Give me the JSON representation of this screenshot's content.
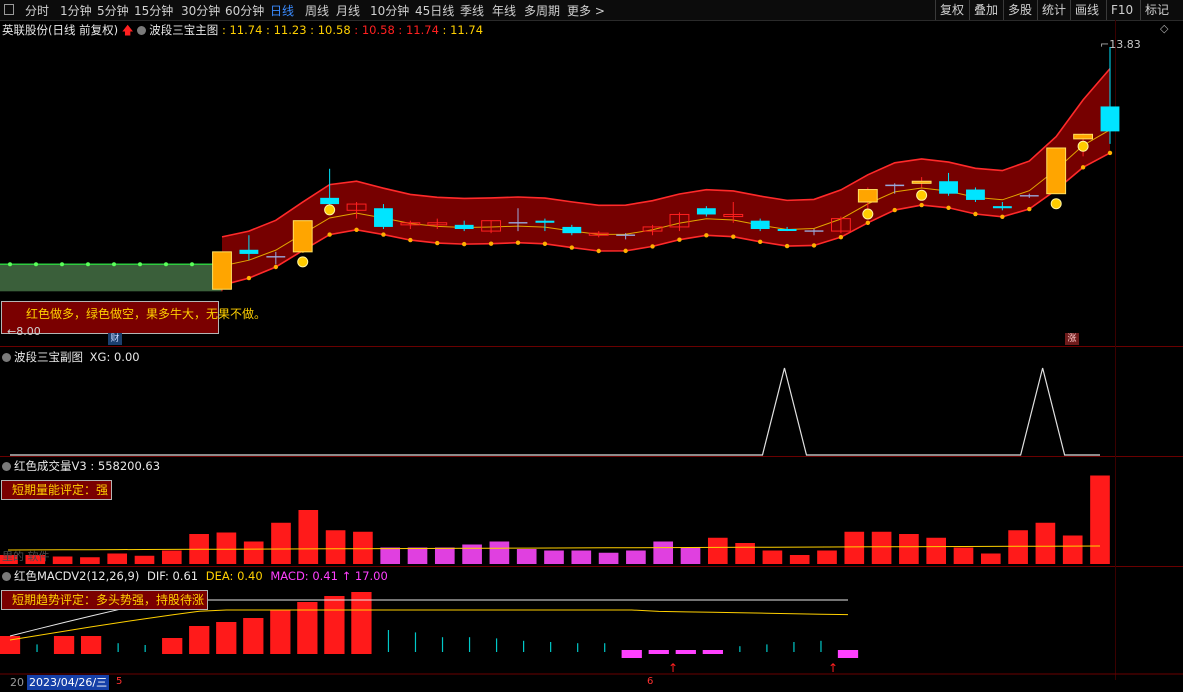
{
  "toolbar": {
    "menu_icon": "menu-icon",
    "tabs": [
      "分时",
      "1分钟",
      "5分钟",
      "15分钟",
      "30分钟",
      "60分钟",
      "日线",
      "周线",
      "月线",
      "10分钟",
      "45日线",
      "季线",
      "年线",
      "多周期",
      "更多 >"
    ],
    "active_tab": "日线",
    "right_buttons": [
      "复权",
      "叠加",
      "多股",
      "统计",
      "画线",
      "F10",
      "标记"
    ]
  },
  "main_panel": {
    "stock_title": "英联股份(日线 前复权)",
    "indicator_name": "波段三宝主图",
    "values": [
      {
        "text": "11.74",
        "color": "#ffd000"
      },
      {
        "text": "11.23",
        "color": "#ffd000"
      },
      {
        "text": "10.58",
        "color": "#ffd000"
      },
      {
        "text": "10.58",
        "color": "#ff2020"
      },
      {
        "text": "11.74",
        "color": "#ff2020"
      },
      {
        "text": "11.74",
        "color": "#ffd000"
      }
    ],
    "high_label": "13.83",
    "low_label": "←8.00",
    "callout": "红色做多，绿色做空，果多牛大，无果不做。",
    "marker_cai": "财",
    "marker_zhang": "涨"
  },
  "panel2": {
    "name": "波段三宝副图",
    "values": "XG: 0.00"
  },
  "panel3": {
    "name": "红色成交量V3",
    "values": ": 558200.63",
    "callout": "短期量能评定：强",
    "overlay_text": "里的 软件"
  },
  "panel4": {
    "name": "红色MACDV2(12,26,9)",
    "dif": "DIF: 0.61",
    "dea": "DEA: 0.40",
    "macd": "MACD: 0.41 ↑ 17.00",
    "callout": "短期趋势评定：多头势强，持股待涨",
    "date_prefix": "20",
    "date": "2023/04/26/三",
    "axis_marks": [
      "5",
      "6"
    ]
  },
  "colors": {
    "up": "#ff2020",
    "down": "#00e5ff",
    "channel": "#8b0000",
    "green_band": "#3a5f3a",
    "ma": "#ffd000",
    "accent": "#3a8bff"
  },
  "chart_data": {
    "type": "candlestick",
    "y_axis_price_range": [
      7.5,
      14.0
    ],
    "candles": [
      {
        "o": 8.0,
        "h": 8.9,
        "l": 7.95,
        "c": 8.9,
        "dir": "up",
        "gold": true
      },
      {
        "o": 8.95,
        "h": 9.3,
        "l": 8.7,
        "c": 8.85,
        "dir": "down"
      },
      {
        "o": 8.75,
        "h": 8.9,
        "l": 8.6,
        "c": 8.78,
        "dir": "cross"
      },
      {
        "o": 8.9,
        "h": 9.65,
        "l": 8.9,
        "c": 9.65,
        "dir": "up",
        "gold": true
      },
      {
        "o": 10.2,
        "h": 10.9,
        "l": 9.8,
        "c": 10.05,
        "dir": "down"
      },
      {
        "o": 9.9,
        "h": 10.1,
        "l": 9.7,
        "c": 10.05,
        "dir": "up"
      },
      {
        "o": 9.95,
        "h": 10.05,
        "l": 9.45,
        "c": 9.5,
        "dir": "down"
      },
      {
        "o": 9.55,
        "h": 9.65,
        "l": 9.45,
        "c": 9.6,
        "dir": "up"
      },
      {
        "o": 9.55,
        "h": 9.7,
        "l": 9.45,
        "c": 9.6,
        "dir": "up"
      },
      {
        "o": 9.55,
        "h": 9.65,
        "l": 9.4,
        "c": 9.45,
        "dir": "down"
      },
      {
        "o": 9.4,
        "h": 9.65,
        "l": 9.35,
        "c": 9.65,
        "dir": "up"
      },
      {
        "o": 9.6,
        "h": 9.95,
        "l": 9.4,
        "c": 9.6,
        "dir": "cross"
      },
      {
        "o": 9.65,
        "h": 9.7,
        "l": 9.4,
        "c": 9.6,
        "dir": "down"
      },
      {
        "o": 9.5,
        "h": 9.55,
        "l": 9.3,
        "c": 9.35,
        "dir": "down"
      },
      {
        "o": 9.3,
        "h": 9.4,
        "l": 9.25,
        "c": 9.35,
        "dir": "up"
      },
      {
        "o": 9.3,
        "h": 9.35,
        "l": 9.2,
        "c": 9.3,
        "dir": "cross"
      },
      {
        "o": 9.4,
        "h": 9.55,
        "l": 9.3,
        "c": 9.5,
        "dir": "up"
      },
      {
        "o": 9.5,
        "h": 9.85,
        "l": 9.4,
        "c": 9.8,
        "dir": "up"
      },
      {
        "o": 9.95,
        "h": 10.0,
        "l": 9.75,
        "c": 9.8,
        "dir": "down"
      },
      {
        "o": 9.75,
        "h": 10.1,
        "l": 9.6,
        "c": 9.8,
        "dir": "up"
      },
      {
        "o": 9.65,
        "h": 9.7,
        "l": 9.4,
        "c": 9.45,
        "dir": "down"
      },
      {
        "o": 9.45,
        "h": 9.5,
        "l": 9.4,
        "c": 9.45,
        "dir": "down"
      },
      {
        "o": 9.4,
        "h": 9.45,
        "l": 9.3,
        "c": 9.4,
        "dir": "cross"
      },
      {
        "o": 9.4,
        "h": 9.75,
        "l": 9.35,
        "c": 9.7,
        "dir": "up"
      },
      {
        "o": 10.1,
        "h": 10.45,
        "l": 9.7,
        "c": 10.4,
        "dir": "up",
        "gold": true
      },
      {
        "o": 10.5,
        "h": 10.55,
        "l": 10.3,
        "c": 10.5,
        "dir": "cross"
      },
      {
        "o": 10.55,
        "h": 10.7,
        "l": 10.45,
        "c": 10.6,
        "dir": "up",
        "gold": true
      },
      {
        "o": 10.6,
        "h": 10.8,
        "l": 10.25,
        "c": 10.3,
        "dir": "down"
      },
      {
        "o": 10.4,
        "h": 10.45,
        "l": 10.1,
        "c": 10.15,
        "dir": "down"
      },
      {
        "o": 10.0,
        "h": 10.1,
        "l": 9.9,
        "c": 9.95,
        "dir": "down"
      },
      {
        "o": 10.25,
        "h": 10.3,
        "l": 10.2,
        "c": 10.25,
        "dir": "cross"
      },
      {
        "o": 10.3,
        "h": 11.4,
        "l": 10.3,
        "c": 11.4,
        "dir": "up",
        "gold": true
      },
      {
        "o": 11.73,
        "h": 11.75,
        "l": 11.2,
        "c": 11.62,
        "dir": "up",
        "gold": true
      },
      {
        "o": 11.8,
        "h": 13.83,
        "l": 11.5,
        "c": 12.4,
        "dir": "down"
      }
    ],
    "panel2_xg": [
      0,
      0,
      0,
      0,
      0,
      0,
      0,
      0,
      0,
      0,
      0,
      0,
      0,
      0,
      0,
      0,
      0,
      0,
      0,
      0,
      0,
      0,
      0,
      0,
      0,
      0,
      0,
      1,
      0,
      0,
      0,
      0,
      0,
      0,
      0,
      0,
      1,
      0,
      0
    ],
    "volume": [
      {
        "v": 12,
        "c": "red"
      },
      {
        "v": 12,
        "c": "red"
      },
      {
        "v": 10,
        "c": "red"
      },
      {
        "v": 9,
        "c": "red"
      },
      {
        "v": 14,
        "c": "red"
      },
      {
        "v": 11,
        "c": "red"
      },
      {
        "v": 18,
        "c": "red"
      },
      {
        "v": 40,
        "c": "red"
      },
      {
        "v": 42,
        "c": "red"
      },
      {
        "v": 30,
        "c": "red"
      },
      {
        "v": 55,
        "c": "red"
      },
      {
        "v": 72,
        "c": "red"
      },
      {
        "v": 45,
        "c": "red"
      },
      {
        "v": 43,
        "c": "red"
      },
      {
        "v": 22,
        "c": "magenta"
      },
      {
        "v": 22,
        "c": "magenta"
      },
      {
        "v": 22,
        "c": "magenta"
      },
      {
        "v": 26,
        "c": "magenta"
      },
      {
        "v": 30,
        "c": "magenta"
      },
      {
        "v": 20,
        "c": "magenta"
      },
      {
        "v": 18,
        "c": "magenta"
      },
      {
        "v": 18,
        "c": "magenta"
      },
      {
        "v": 15,
        "c": "magenta"
      },
      {
        "v": 18,
        "c": "magenta"
      },
      {
        "v": 30,
        "c": "magenta"
      },
      {
        "v": 22,
        "c": "magenta"
      },
      {
        "v": 35,
        "c": "red"
      },
      {
        "v": 28,
        "c": "red"
      },
      {
        "v": 18,
        "c": "red"
      },
      {
        "v": 12,
        "c": "red"
      },
      {
        "v": 18,
        "c": "red"
      },
      {
        "v": 43,
        "c": "red"
      },
      {
        "v": 43,
        "c": "red"
      },
      {
        "v": 40,
        "c": "red"
      },
      {
        "v": 35,
        "c": "red"
      },
      {
        "v": 22,
        "c": "red"
      },
      {
        "v": 14,
        "c": "red"
      },
      {
        "v": 45,
        "c": "red"
      },
      {
        "v": 55,
        "c": "red"
      },
      {
        "v": 38,
        "c": "red"
      },
      {
        "v": 118,
        "c": "red"
      }
    ],
    "macd_bars": [
      {
        "v": 12,
        "c": "red"
      },
      {
        "v": 6,
        "c": "cyan"
      },
      {
        "v": 12,
        "c": "red"
      },
      {
        "v": 12,
        "c": "red"
      },
      {
        "v": 8,
        "c": "cyan"
      },
      {
        "v": 5,
        "c": "cyan"
      },
      {
        "v": 10,
        "c": "red"
      },
      {
        "v": 22,
        "c": "red"
      },
      {
        "v": 26,
        "c": "red"
      },
      {
        "v": 30,
        "c": "red"
      },
      {
        "v": 38,
        "c": "red"
      },
      {
        "v": 46,
        "c": "red"
      },
      {
        "v": 52,
        "c": "red"
      },
      {
        "v": 56,
        "c": "red"
      },
      {
        "v": -30,
        "c": "cyan"
      },
      {
        "v": -26,
        "c": "cyan"
      },
      {
        "v": -18,
        "c": "cyan"
      },
      {
        "v": -18,
        "c": "cyan"
      },
      {
        "v": -16,
        "c": "cyan"
      },
      {
        "v": -12,
        "c": "cyan"
      },
      {
        "v": -10,
        "c": "cyan"
      },
      {
        "v": -8,
        "c": "cyan"
      },
      {
        "v": -8,
        "c": "cyan"
      },
      {
        "v": -10,
        "c": "magenta"
      },
      {
        "v": -5,
        "c": "magenta"
      },
      {
        "v": -5,
        "c": "magenta"
      },
      {
        "v": -3,
        "c": "magenta"
      },
      {
        "v": -3,
        "c": "cyan"
      },
      {
        "v": -6,
        "c": "cyan"
      },
      {
        "v": -10,
        "c": "cyan"
      },
      {
        "v": -12,
        "c": "cyan"
      },
      {
        "v": -10,
        "c": "magenta"
      }
    ]
  }
}
